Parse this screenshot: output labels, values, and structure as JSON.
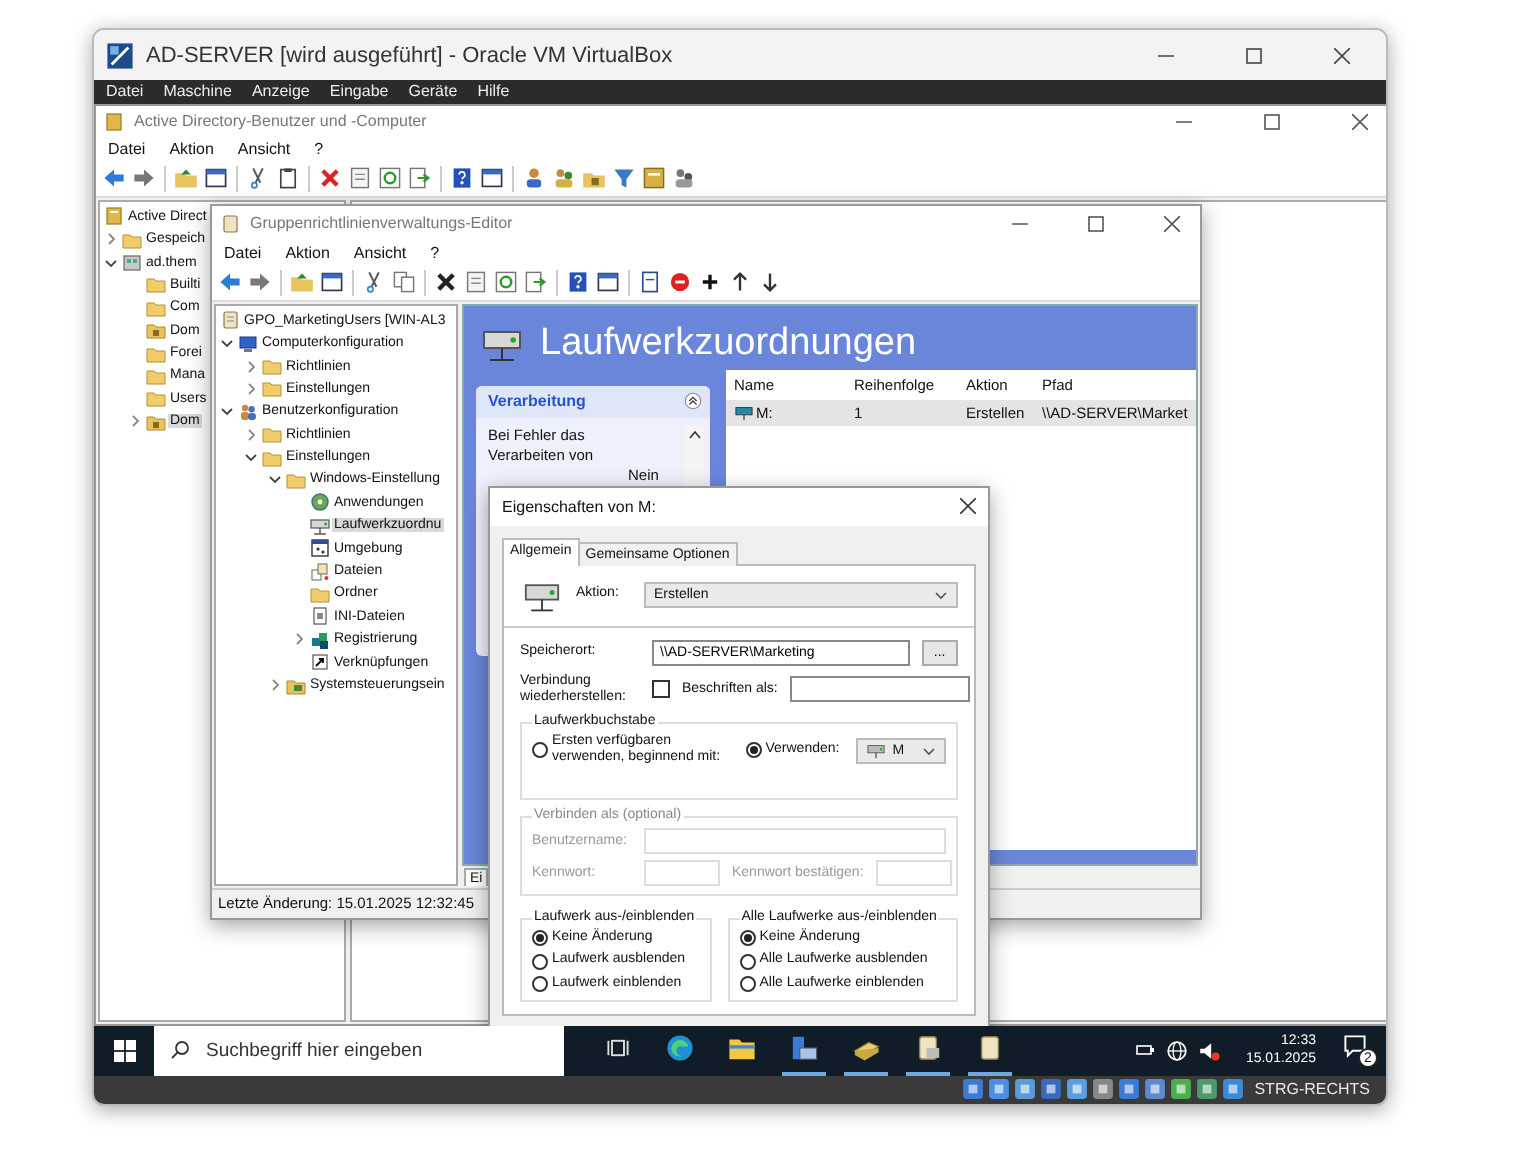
{
  "vbox": {
    "title": "AD-SERVER [wird ausgeführt] - Oracle VM VirtualBox",
    "menu": [
      "Datei",
      "Maschine",
      "Anzeige",
      "Eingabe",
      "Geräte",
      "Hilfe"
    ],
    "host_key": "STRG-RECHTS"
  },
  "aduc": {
    "title": "Active Directory-Benutzer und -Computer",
    "menu": [
      "Datei",
      "Aktion",
      "Ansicht",
      "?"
    ],
    "tree": [
      {
        "label": "Active Direct",
        "kind": "root",
        "selected": false,
        "children": [
          {
            "label": "Gespeich",
            "kind": "folder",
            "expanded": false,
            "selected": false
          },
          {
            "label": "ad.them",
            "kind": "domain",
            "expanded": true,
            "selected": false,
            "children": [
              {
                "label": "Builti",
                "kind": "folder",
                "selected": false
              },
              {
                "label": "Com",
                "kind": "folder",
                "selected": false
              },
              {
                "label": "Dom",
                "kind": "ou",
                "selected": false
              },
              {
                "label": "Forei",
                "kind": "folder",
                "selected": false
              },
              {
                "label": "Mana",
                "kind": "folder",
                "selected": false
              },
              {
                "label": "Users",
                "kind": "folder",
                "selected": false
              },
              {
                "label": "Dom",
                "kind": "ou",
                "expanded": false,
                "selected": true
              }
            ]
          }
        ]
      }
    ]
  },
  "gpme": {
    "title": "Gruppenrichtlinienverwaltungs-Editor",
    "menu": [
      "Datei",
      "Aktion",
      "Ansicht",
      "?"
    ],
    "tree": [
      {
        "label": "GPO_MarketingUsers [WIN-AL3",
        "kind": "gpo",
        "selected": false,
        "children": [
          {
            "label": "Computerkonfiguration",
            "kind": "computer",
            "expanded": true,
            "selected": false,
            "children": [
              {
                "label": "Richtlinien",
                "kind": "folder",
                "expanded": false,
                "selected": false
              },
              {
                "label": "Einstellungen",
                "kind": "folder",
                "expanded": false,
                "selected": false
              }
            ]
          },
          {
            "label": "Benutzerkonfiguration",
            "kind": "users",
            "expanded": true,
            "selected": false,
            "children": [
              {
                "label": "Richtlinien",
                "kind": "folder",
                "expanded": false,
                "selected": false
              },
              {
                "label": "Einstellungen",
                "kind": "folder",
                "expanded": true,
                "selected": false,
                "children": [
                  {
                    "label": "Windows-Einstellung",
                    "kind": "folder",
                    "expanded": true,
                    "selected": false,
                    "children": [
                      {
                        "label": "Anwendungen",
                        "kind": "app",
                        "selected": false
                      },
                      {
                        "label": "Laufwerkzuordnu",
                        "kind": "drive",
                        "selected": true
                      },
                      {
                        "label": "Umgebung",
                        "kind": "env",
                        "selected": false
                      },
                      {
                        "label": "Dateien",
                        "kind": "files",
                        "selected": false
                      },
                      {
                        "label": "Ordner",
                        "kind": "folder",
                        "selected": false
                      },
                      {
                        "label": "INI-Dateien",
                        "kind": "ini",
                        "selected": false
                      },
                      {
                        "label": "Registrierung",
                        "kind": "registry",
                        "expanded": false,
                        "selected": false
                      },
                      {
                        "label": "Verknüpfungen",
                        "kind": "shortcut",
                        "selected": false
                      }
                    ]
                  },
                  {
                    "label": "Systemsteuerungsein",
                    "kind": "panel",
                    "expanded": false,
                    "selected": false
                  }
                ]
              }
            ]
          }
        ]
      }
    ],
    "status": "Letzte Änderung: 15.01.2025 12:32:45",
    "heading": "Laufwerkzuordnungen",
    "side_panel": {
      "title": "Verarbeitung",
      "text": "Bei Fehler das Verarbeiten von",
      "value": "Nein"
    },
    "columns": [
      "Name",
      "Reihenfolge",
      "Aktion",
      "Pfad"
    ],
    "rows": [
      {
        "cells": [
          "M:",
          "1",
          "Erstellen",
          "\\\\AD-SERVER\\Market"
        ],
        "selected": true
      }
    ],
    "bottom_tab": "Ei"
  },
  "dialog": {
    "title": "Eigenschaften von M:",
    "tabs": [
      {
        "label": "Allgemein",
        "selected": true
      },
      {
        "label": "Gemeinsame Optionen",
        "selected": false
      }
    ],
    "action": {
      "label": "Aktion:",
      "value": "Erstellen"
    },
    "location": {
      "label": "Speicherort:",
      "value": "\\\\AD-SERVER\\Marketing",
      "browse": "..."
    },
    "reconnect": {
      "label": "Verbindung wiederherstellen:",
      "checked": false
    },
    "label_as": {
      "label": "Beschriften als:"
    },
    "drive_letter": {
      "title": "Laufwerkbuchstabe",
      "options": [
        {
          "label": "Ersten verfügbaren verwenden, beginnend mit:",
          "selected": false
        },
        {
          "label": "Verwenden:",
          "selected": true
        }
      ],
      "letter": "M"
    },
    "connect_as": {
      "title": "Verbinden als (optional)",
      "disabled": true,
      "username": "Benutzername:",
      "password": "Kennwort:",
      "confirm": "Kennwort bestätigen:"
    },
    "hide_drive": {
      "title": "Laufwerk aus-/einblenden",
      "options": [
        {
          "label": "Keine Änderung",
          "selected": true
        },
        {
          "label": "Laufwerk ausblenden",
          "selected": false
        },
        {
          "label": "Laufwerk einblenden",
          "selected": false
        }
      ]
    },
    "hide_all": {
      "title": "Alle Laufwerke aus-/einblenden",
      "options": [
        {
          "label": "Keine Änderung",
          "selected": true
        },
        {
          "label": "Alle Laufwerke ausblenden",
          "selected": false
        },
        {
          "label": "Alle Laufwerke einblenden",
          "selected": false
        }
      ]
    }
  },
  "taskbar": {
    "search_placeholder": "Suchbegriff hier eingeben",
    "time": "12:33",
    "date": "15.01.2025",
    "notifications": "2"
  }
}
